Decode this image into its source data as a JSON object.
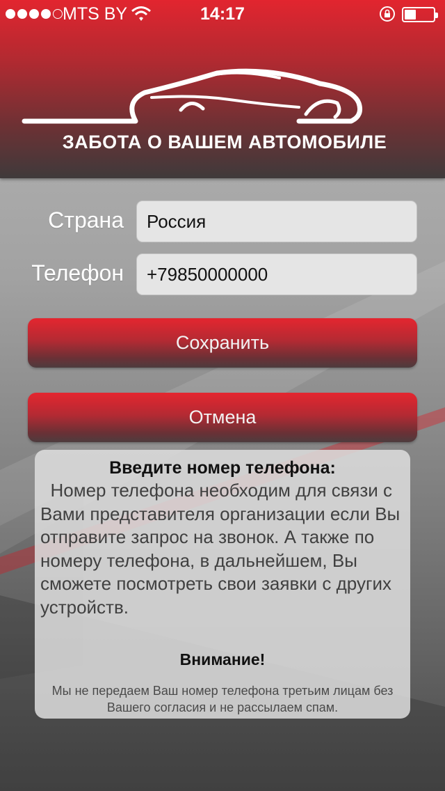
{
  "status_bar": {
    "carrier": "MTS BY",
    "time": "14:17",
    "signal_bars_filled": 4,
    "signal_bars_total": 5
  },
  "header": {
    "slogan": "ЗАБОТА О ВАШЕМ АВТОМОБИЛЕ"
  },
  "form": {
    "country_label": "Страна",
    "country_value": "Россия",
    "phone_label": "Телефон",
    "phone_value": "+79850000000"
  },
  "buttons": {
    "save": "Сохранить",
    "cancel": "Отмена"
  },
  "info": {
    "title": "Введите номер телефона:",
    "body": "  Номер телефона необходим для связи с Вами представителя организации если Вы отправите запрос на звонок. А также по номеру телефона, в дальнейшем, Вы сможете посмотреть свои заявки с других устройств.",
    "warning_title": "Внимание!",
    "warning_text": "Мы не передаем Ваш номер телефона третьим лицам без Вашего согласия и не рассылаем спам."
  },
  "colors": {
    "accent_red": "#e2252f",
    "dark_gray": "#3f3a3b"
  }
}
